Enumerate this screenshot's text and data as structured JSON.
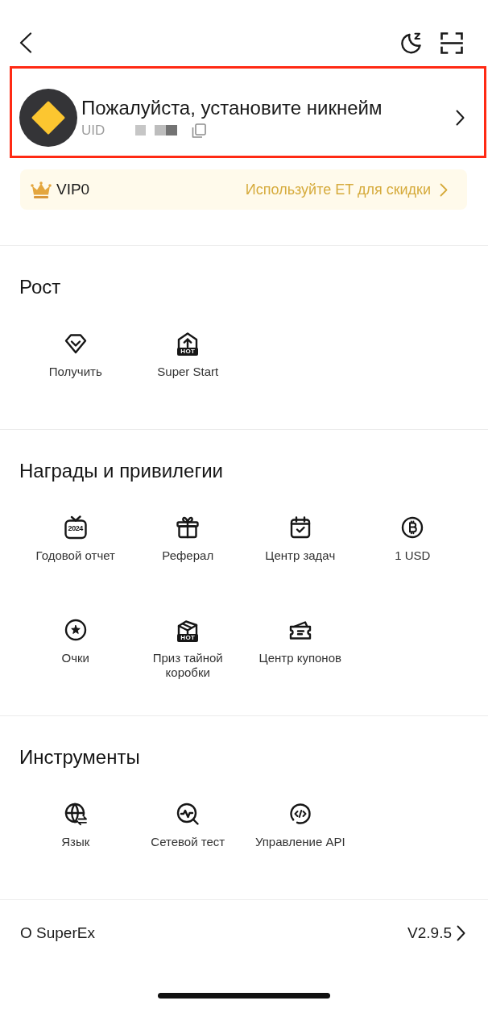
{
  "profile": {
    "highlighted": true,
    "nickname": "Пожалуйста, установите никнейм",
    "uid_label": "UID"
  },
  "vip": {
    "tier": "VIP0",
    "promo": "Используйте ET для скидки"
  },
  "sections": [
    {
      "title": "Рост",
      "items": [
        {
          "kind": "gem",
          "label": "Получить"
        },
        {
          "kind": "upload",
          "label": "Super Start",
          "badge": "HOT"
        }
      ]
    },
    {
      "title": "Награды и привилегии",
      "items": [
        {
          "kind": "tv",
          "label": "Годовой отчет",
          "icon_text": "2024"
        },
        {
          "kind": "gift",
          "label": "Реферал"
        },
        {
          "kind": "calendar",
          "label": "Центр задач"
        },
        {
          "kind": "bitcoin",
          "label": "1 USD"
        },
        {
          "kind": "star",
          "label": "Очки"
        },
        {
          "kind": "box",
          "label": "Приз тайной коробки",
          "badge": "HOT"
        },
        {
          "kind": "ticket",
          "label": "Центр купонов"
        }
      ]
    },
    {
      "title": "Инструменты",
      "items": [
        {
          "kind": "globe",
          "label": "Язык"
        },
        {
          "kind": "pulse",
          "label": "Сетевой тест"
        },
        {
          "kind": "code",
          "label": "Управление API"
        }
      ]
    }
  ],
  "about": {
    "label": "О SuperEx",
    "version": "V2.9.5"
  }
}
